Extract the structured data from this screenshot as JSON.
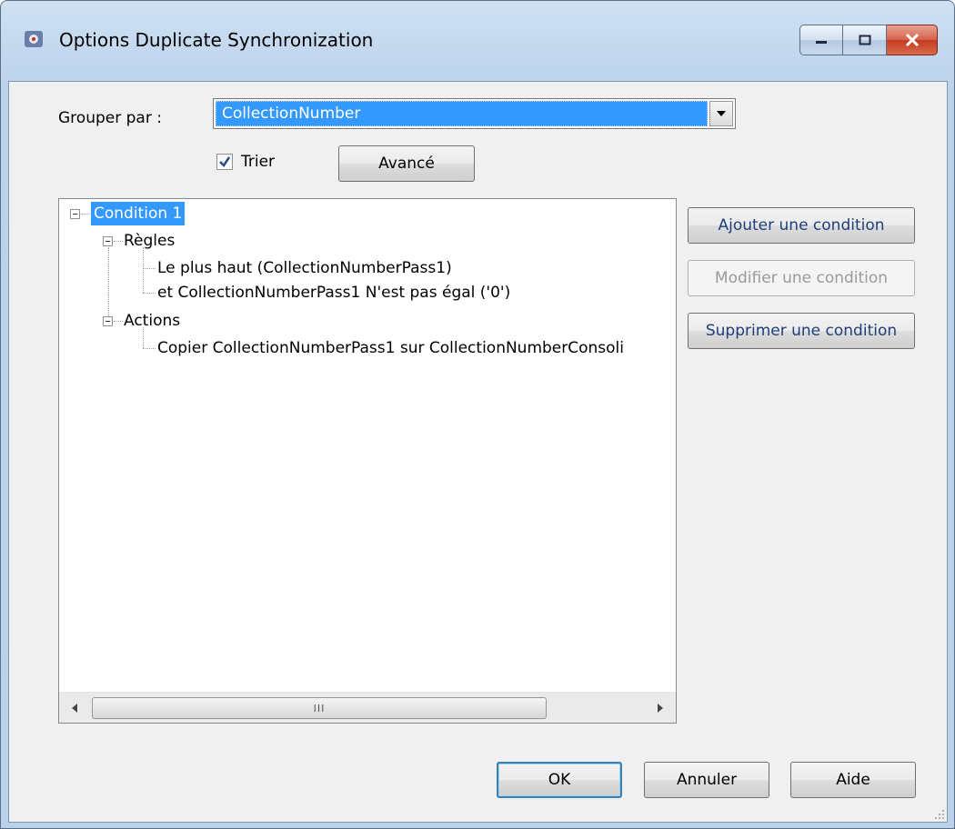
{
  "window": {
    "title": "Options Duplicate Synchronization",
    "app_icon": "app-settings-icon",
    "minimize_icon": "minimize-icon",
    "maximize_icon": "maximize-icon",
    "close_icon": "close-icon"
  },
  "group": {
    "label": "Grouper par :",
    "selected_value": "CollectionNumber",
    "dropdown_icon": "chevron-down-icon"
  },
  "sort": {
    "label": "Trier",
    "checked": true,
    "advanced_button": "Avancé"
  },
  "tree": {
    "condition": "Condition 1",
    "rules_label": "Règles",
    "rule_1": "Le plus haut (CollectionNumberPass1)",
    "rule_2": "et CollectionNumberPass1 N'est pas égal ('0')",
    "actions_label": "Actions",
    "action_1": "Copier CollectionNumberPass1 sur CollectionNumberConsoli",
    "scroll_thumb_label": "III"
  },
  "side_buttons": {
    "add": "Ajouter une condition",
    "modify": "Modifier une condition",
    "delete": "Supprimer une condition"
  },
  "footer": {
    "ok": "OK",
    "cancel": "Annuler",
    "help": "Aide"
  },
  "colors": {
    "selection": "#3399ff",
    "dialog_bg": "#f0f0f0",
    "frame": "#b9d1ea"
  }
}
